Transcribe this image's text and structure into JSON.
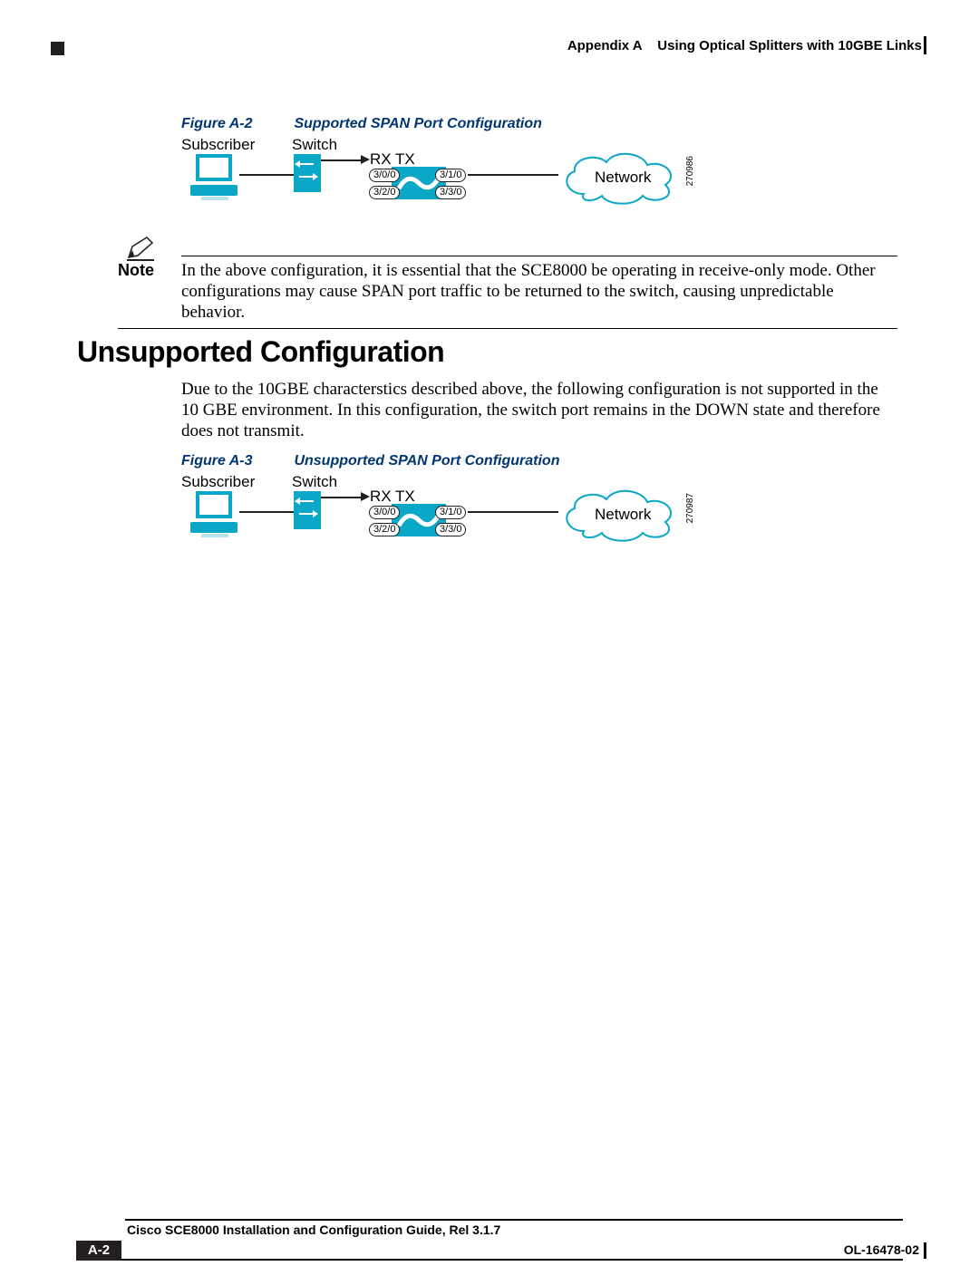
{
  "header": {
    "appendix": "Appendix A",
    "title": "Using Optical Splitters with 10GBE Links"
  },
  "figureA2": {
    "num": "Figure A-2",
    "title": "Supported SPAN Port Configuration",
    "subscriber": "Subscriber",
    "switch": "Switch",
    "rxtx": "RX  TX",
    "ports": {
      "p1": "3/0/0",
      "p2": "3/1/0",
      "p3": "3/2/0",
      "p4": "3/3/0"
    },
    "network": "Network",
    "imgid": "270986"
  },
  "note": {
    "label": "Note",
    "body": "In the above configuration, it is essential that the SCE8000 be operating in receive-only mode. Other configurations may cause SPAN port traffic to be returned to the switch, causing unpredictable behavior."
  },
  "heading": "Unsupported Configuration",
  "para": "Due to the 10GBE characterstics described above, the following configuration is not supported in the 10 GBE environment. In this configuration, the switch port remains in the DOWN state and therefore does not transmit.",
  "figureA3": {
    "num": "Figure A-3",
    "title": "Unsupported SPAN Port Configuration",
    "subscriber": "Subscriber",
    "switch": "Switch",
    "rxtx": "RX  TX",
    "ports": {
      "p1": "3/0/0",
      "p2": "3/1/0",
      "p3": "3/2/0",
      "p4": "3/3/0"
    },
    "network": "Network",
    "imgid": "270987"
  },
  "footer": {
    "bookTitle": "Cisco SCE8000 Installation and Configuration Guide, Rel 3.1.7",
    "pageNum": "A-2",
    "docId": "OL-16478-02"
  }
}
